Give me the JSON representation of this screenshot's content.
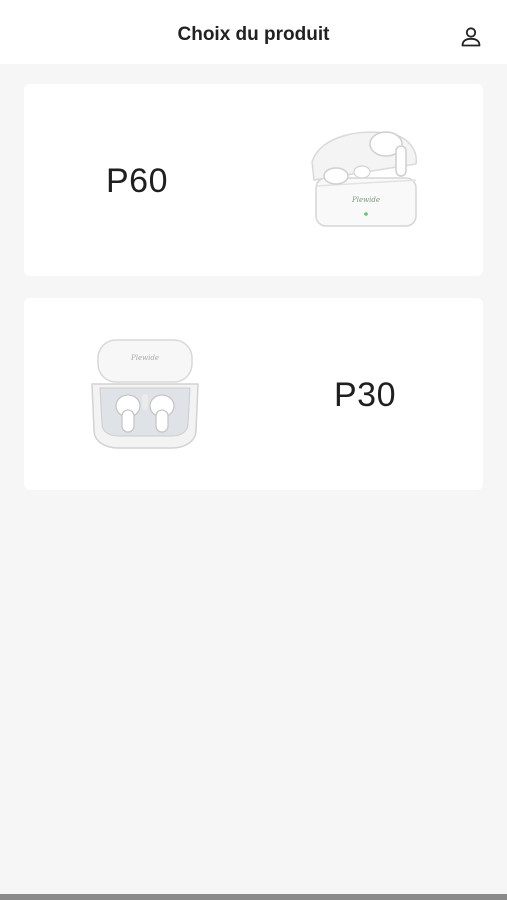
{
  "header": {
    "title": "Choix du produit",
    "profile_icon": "user-icon"
  },
  "products": [
    {
      "label": "P60",
      "image": "earbuds-open-case-image"
    },
    {
      "label": "P30",
      "image": "earbuds-clamshell-case-image"
    }
  ],
  "colors": {
    "background": "#f6f6f6",
    "card": "#ffffff",
    "text": "#1f1f1f"
  }
}
